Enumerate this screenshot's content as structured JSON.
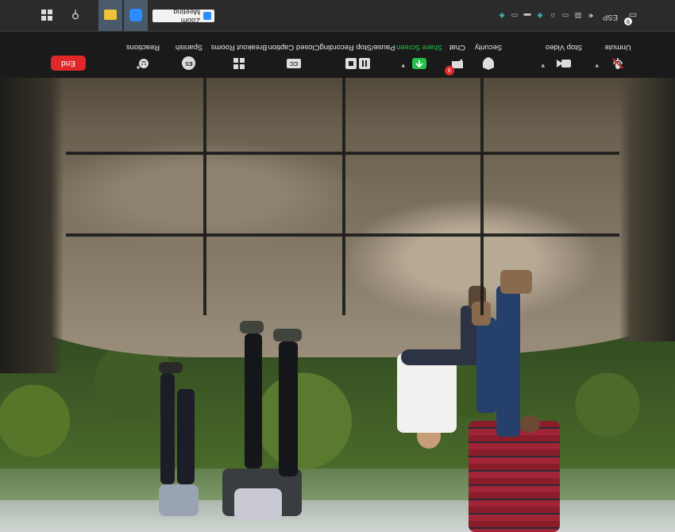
{
  "toolbar": {
    "unmute": {
      "label": "Unmute",
      "icon": "mic-muted-icon"
    },
    "stop_video": {
      "label": "Stop Video",
      "icon": "video-camera-icon"
    },
    "security": {
      "label": "Security",
      "icon": "shield-icon"
    },
    "chat": {
      "label": "Chat",
      "icon": "chat-bubble-icon",
      "badge": "3"
    },
    "share_screen": {
      "label": "Share Screen",
      "icon": "share-arrow-icon",
      "color": "#25c24b"
    },
    "recording": {
      "label": "Pause/Stop Recording",
      "icon": "pause-stop-icon"
    },
    "closed_caption": {
      "label": "Closed Caption",
      "icon": "cc-icon",
      "glyph": "CC"
    },
    "breakout_rooms": {
      "label": "Breakout Rooms",
      "icon": "grid-icon"
    },
    "spanish": {
      "label": "Spanish",
      "icon": "language-icon",
      "glyph": "ES"
    },
    "reactions": {
      "label": "Reactions",
      "icon": "smiley-plus-icon"
    },
    "end": {
      "label": "End",
      "color": "#e02828"
    }
  },
  "taskbar": {
    "window_title": "Zoom Meeting",
    "language": "ESP",
    "notification_count": "9",
    "colors": {
      "active_app": "#4a5a6b",
      "bar": "#2b2b2b"
    }
  },
  "scene": {
    "grid_rows": 3,
    "grid_cols": 4
  }
}
